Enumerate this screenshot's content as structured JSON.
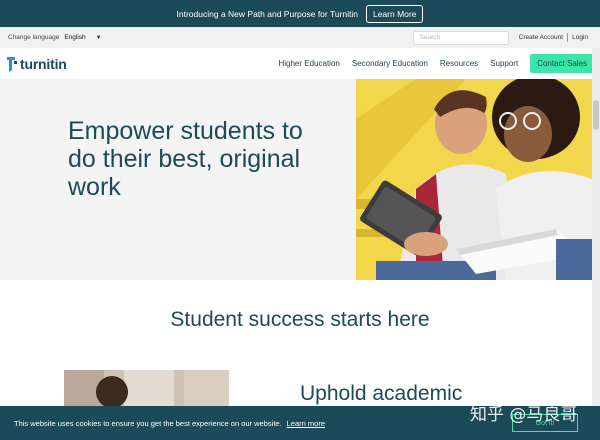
{
  "announcement": {
    "text": "Introducing a New Path and Purpose for Turnitin",
    "button": "Learn More"
  },
  "utility": {
    "language_label": "Change language",
    "language_value": "English",
    "search_placeholder": "Search",
    "create_account": "Create Account",
    "login": "Login"
  },
  "nav": {
    "logo_text": "turnitin",
    "items": [
      {
        "label": "Higher Education"
      },
      {
        "label": "Secondary Education"
      },
      {
        "label": "Resources"
      },
      {
        "label": "Support"
      }
    ],
    "cta": "Contact Sales"
  },
  "hero": {
    "title": "Empower students to do their best, original work"
  },
  "section": {
    "title": "Student success starts here",
    "subtitle": "Uphold academic"
  },
  "cookie": {
    "text": "This website uses cookies to ensure you get the best experience on our website.",
    "link": "Learn more",
    "button": "Got it!"
  },
  "watermark": "知乎 @马良哥",
  "colors": {
    "brand_dark": "#1b4a58",
    "accent_green": "#3ce6a8",
    "hero_bg": "#f4f4f4",
    "photo_yellow": "#f2d64c"
  }
}
